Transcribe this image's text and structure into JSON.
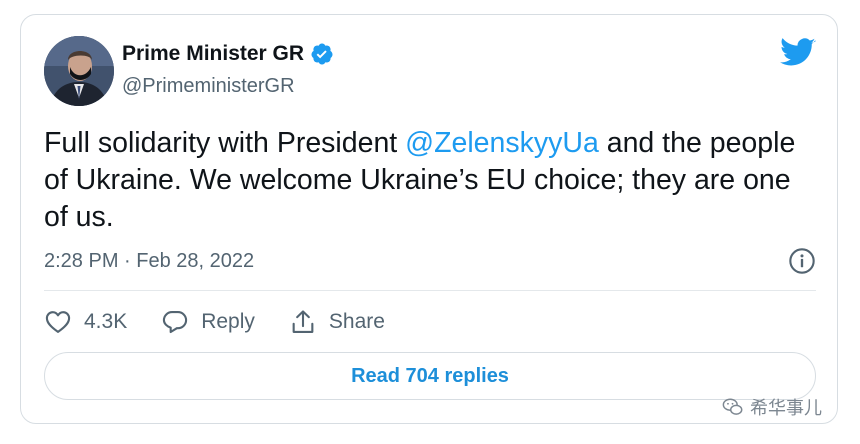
{
  "tweet": {
    "display_name": "Prime Minister GR",
    "handle": "@PrimeministerGR",
    "text_before": "Full solidarity with President ",
    "mention": "@ZelenskyyUa",
    "text_after": " and the people of Ukraine. We welcome Ukraine’s EU choice; they are one of us.",
    "timestamp": "2:28 PM · Feb 28, 2022",
    "like_count": "4.3K",
    "reply_label": "Reply",
    "share_label": "Share",
    "read_replies_label": "Read 704 replies"
  },
  "watermark": {
    "text": "希华事儿"
  },
  "icons": {
    "verified": "verified-badge-icon",
    "brand": "twitter-bird-icon",
    "info": "info-icon",
    "like": "heart-icon",
    "reply": "reply-bubble-icon",
    "share": "share-icon",
    "watermark": "wechat-icon"
  },
  "colors": {
    "accent": "#1d9bf0",
    "text": "#0f1419",
    "secondary": "#536471",
    "border": "#d7dde2"
  }
}
